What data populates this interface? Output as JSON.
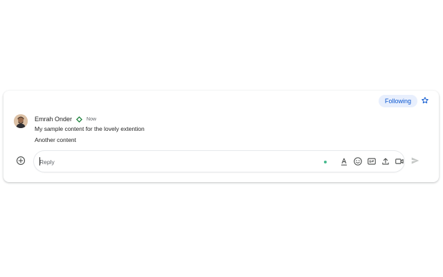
{
  "header": {
    "following_label": "Following",
    "star_icon": "star-outline-icon"
  },
  "comment": {
    "author": "Emrah Onder",
    "timestamp": "Now",
    "badge_icon": "diamond-badge-icon",
    "badge_color": "#188038",
    "lines": [
      "My sample content for the lovely extention",
      "Another content"
    ]
  },
  "composer": {
    "placeholder": "Reply",
    "add_icon": "add-circle-icon",
    "tools": [
      "format-text-icon",
      "emoji-icon",
      "gif-icon",
      "upload-icon",
      "video-call-icon"
    ],
    "send_icon": "send-icon"
  },
  "colors": {
    "accent": "#0b57d0",
    "chip_bg": "#e8effd",
    "status_dot": "#46b98d"
  }
}
